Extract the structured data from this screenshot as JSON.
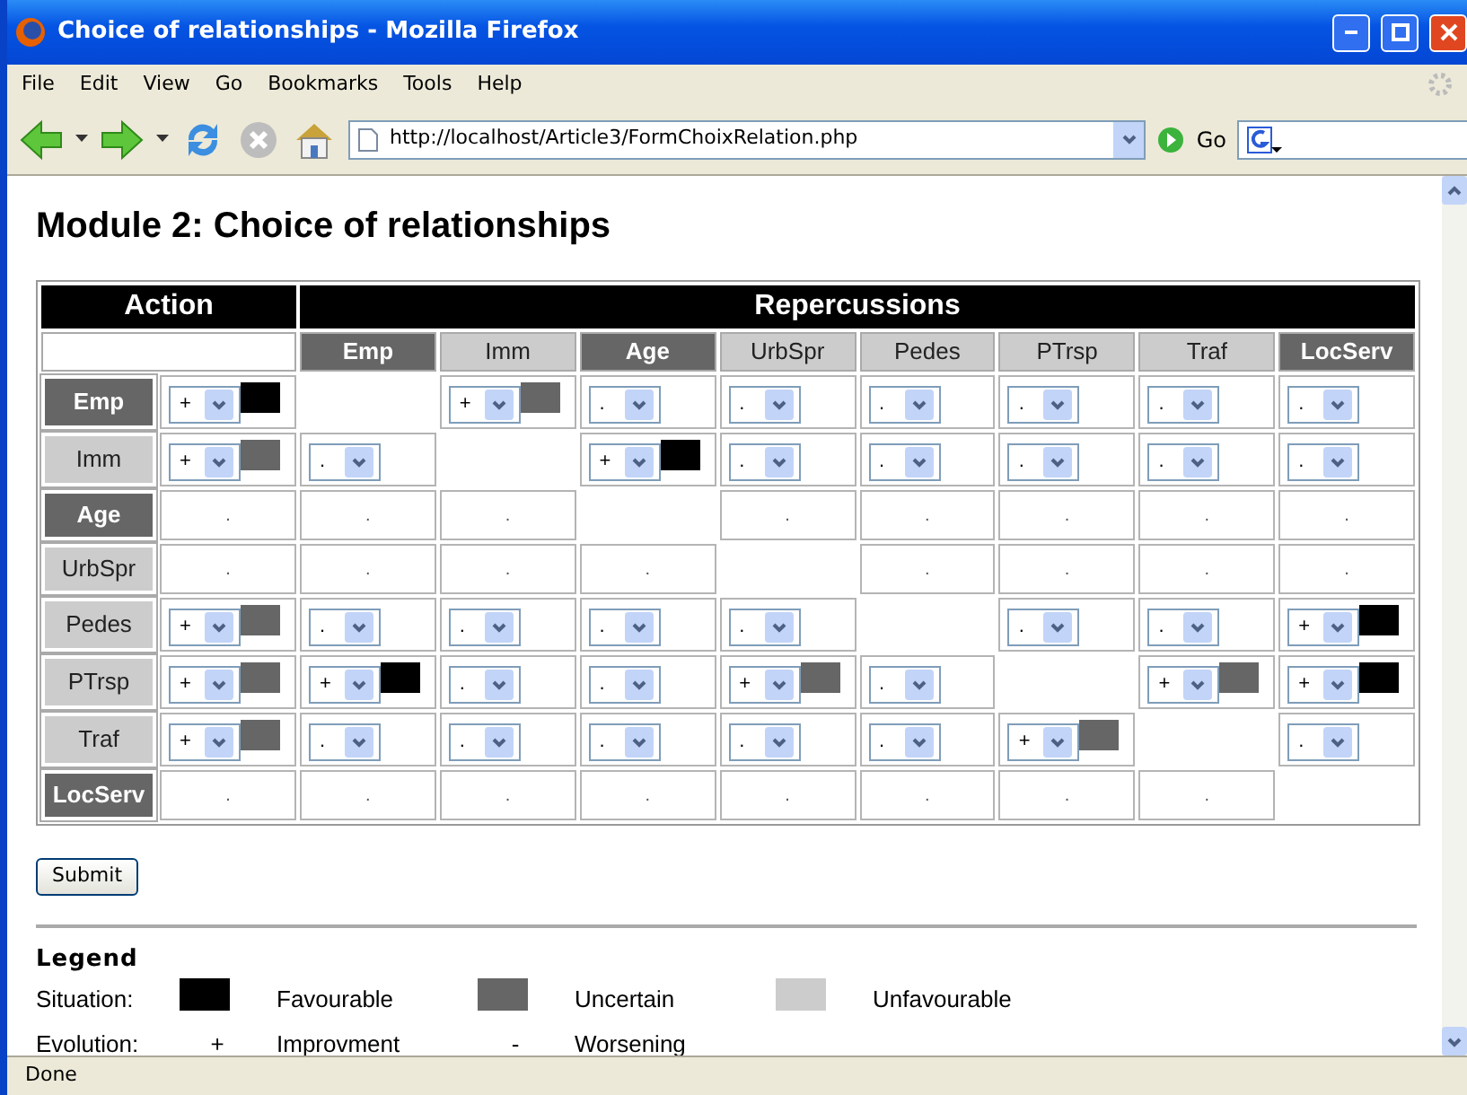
{
  "window": {
    "title": "Choice of relationships - Mozilla Firefox"
  },
  "menu": [
    "File",
    "Edit",
    "View",
    "Go",
    "Bookmarks",
    "Tools",
    "Help"
  ],
  "address": {
    "url": "http://localhost/Article3/FormChoixRelation.php",
    "go_label": "Go"
  },
  "page": {
    "heading": "Module 2: Choice of relationships"
  },
  "table": {
    "action_header": "Action",
    "repercussions_header": "Repercussions",
    "columns": [
      {
        "label": "Emp",
        "color": "#666666"
      },
      {
        "label": "Imm",
        "color": "#cccccc"
      },
      {
        "label": "Age",
        "color": "#666666"
      },
      {
        "label": "UrbSpr",
        "color": "#cccccc"
      },
      {
        "label": "Pedes",
        "color": "#cccccc"
      },
      {
        "label": "PTrsp",
        "color": "#cccccc"
      },
      {
        "label": "Traf",
        "color": "#cccccc"
      },
      {
        "label": "LocServ",
        "color": "#666666"
      }
    ],
    "rows": [
      {
        "label": "Emp",
        "color": "#666666",
        "action": {
          "kind": "select",
          "value": "+",
          "color": "#000000"
        },
        "cells": [
          {
            "kind": "none"
          },
          {
            "kind": "select",
            "value": "+",
            "color": "#666666"
          },
          {
            "kind": "select",
            "value": "."
          },
          {
            "kind": "select",
            "value": "."
          },
          {
            "kind": "select",
            "value": "."
          },
          {
            "kind": "select",
            "value": "."
          },
          {
            "kind": "select",
            "value": "."
          },
          {
            "kind": "select",
            "value": "."
          }
        ]
      },
      {
        "label": "Imm",
        "color": "#cccccc",
        "action": {
          "kind": "select",
          "value": "+",
          "color": "#666666"
        },
        "cells": [
          {
            "kind": "select",
            "value": "."
          },
          {
            "kind": "none"
          },
          {
            "kind": "select",
            "value": "+",
            "color": "#000000"
          },
          {
            "kind": "select",
            "value": "."
          },
          {
            "kind": "select",
            "value": "."
          },
          {
            "kind": "select",
            "value": "."
          },
          {
            "kind": "select",
            "value": "."
          },
          {
            "kind": "select",
            "value": "."
          }
        ]
      },
      {
        "label": "Age",
        "color": "#666666",
        "action": {
          "kind": "text",
          "value": "."
        },
        "cells": [
          {
            "kind": "text",
            "value": "."
          },
          {
            "kind": "text",
            "value": "."
          },
          {
            "kind": "none"
          },
          {
            "kind": "text",
            "value": "."
          },
          {
            "kind": "text",
            "value": "."
          },
          {
            "kind": "text",
            "value": "."
          },
          {
            "kind": "text",
            "value": "."
          },
          {
            "kind": "text",
            "value": "."
          }
        ]
      },
      {
        "label": "UrbSpr",
        "color": "#cccccc",
        "action": {
          "kind": "text",
          "value": "."
        },
        "cells": [
          {
            "kind": "text",
            "value": "."
          },
          {
            "kind": "text",
            "value": "."
          },
          {
            "kind": "text",
            "value": "."
          },
          {
            "kind": "none"
          },
          {
            "kind": "text",
            "value": "."
          },
          {
            "kind": "text",
            "value": "."
          },
          {
            "kind": "text",
            "value": "."
          },
          {
            "kind": "text",
            "value": "."
          }
        ]
      },
      {
        "label": "Pedes",
        "color": "#cccccc",
        "action": {
          "kind": "select",
          "value": "+",
          "color": "#666666"
        },
        "cells": [
          {
            "kind": "select",
            "value": "."
          },
          {
            "kind": "select",
            "value": "."
          },
          {
            "kind": "select",
            "value": "."
          },
          {
            "kind": "select",
            "value": "."
          },
          {
            "kind": "none"
          },
          {
            "kind": "select",
            "value": "."
          },
          {
            "kind": "select",
            "value": "."
          },
          {
            "kind": "select",
            "value": "+",
            "color": "#000000"
          }
        ]
      },
      {
        "label": "PTrsp",
        "color": "#cccccc",
        "action": {
          "kind": "select",
          "value": "+",
          "color": "#666666"
        },
        "cells": [
          {
            "kind": "select",
            "value": "+",
            "color": "#000000"
          },
          {
            "kind": "select",
            "value": "."
          },
          {
            "kind": "select",
            "value": "."
          },
          {
            "kind": "select",
            "value": "+",
            "color": "#666666"
          },
          {
            "kind": "select",
            "value": "."
          },
          {
            "kind": "none"
          },
          {
            "kind": "select",
            "value": "+",
            "color": "#666666"
          },
          {
            "kind": "select",
            "value": "+",
            "color": "#000000"
          }
        ]
      },
      {
        "label": "Traf",
        "color": "#cccccc",
        "action": {
          "kind": "select",
          "value": "+",
          "color": "#666666"
        },
        "cells": [
          {
            "kind": "select",
            "value": "."
          },
          {
            "kind": "select",
            "value": "."
          },
          {
            "kind": "select",
            "value": "."
          },
          {
            "kind": "select",
            "value": "."
          },
          {
            "kind": "select",
            "value": "."
          },
          {
            "kind": "select",
            "value": "+",
            "color": "#666666"
          },
          {
            "kind": "none"
          },
          {
            "kind": "select",
            "value": "."
          }
        ]
      },
      {
        "label": "LocServ",
        "color": "#666666",
        "action": {
          "kind": "text",
          "value": "."
        },
        "cells": [
          {
            "kind": "text",
            "value": "."
          },
          {
            "kind": "text",
            "value": "."
          },
          {
            "kind": "text",
            "value": "."
          },
          {
            "kind": "text",
            "value": "."
          },
          {
            "kind": "text",
            "value": "."
          },
          {
            "kind": "text",
            "value": "."
          },
          {
            "kind": "text",
            "value": "."
          },
          {
            "kind": "none"
          }
        ]
      }
    ]
  },
  "submit": "Submit",
  "legend": {
    "title": "Legend",
    "situation_label": "Situation:",
    "situations": [
      {
        "label": "Favourable",
        "color": "#000000"
      },
      {
        "label": "Uncertain",
        "color": "#666666"
      },
      {
        "label": "Unfavourable",
        "color": "#cccccc"
      }
    ],
    "evolution_label": "Evolution:",
    "evolutions": [
      {
        "symbol": "+",
        "label": "Improvment"
      },
      {
        "symbol": "-",
        "label": "Worsening"
      }
    ]
  },
  "status_bar": "Done"
}
